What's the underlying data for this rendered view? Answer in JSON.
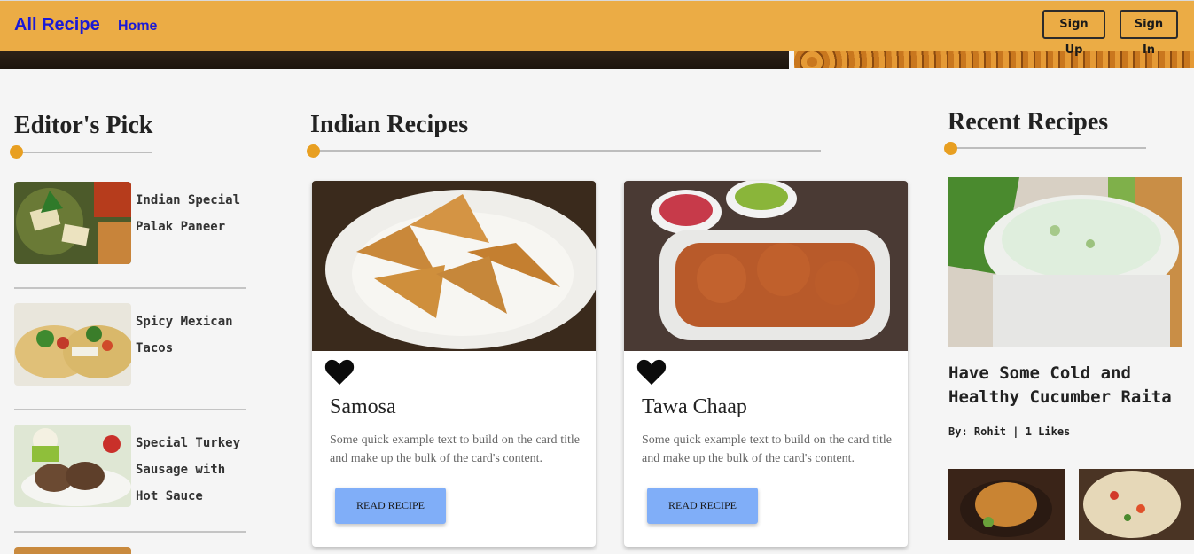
{
  "navbar": {
    "brand": "All Recipe",
    "home": "Home",
    "signup": "Sign Up",
    "signin": "Sign In"
  },
  "editors_pick": {
    "title": "Editor's Pick",
    "items": [
      {
        "title": "Indian Special Palak Paneer"
      },
      {
        "title": "Spicy Mexican Tacos"
      },
      {
        "title": "Special Turkey Sausage with Hot Sauce"
      }
    ]
  },
  "indian": {
    "title": "Indian Recipes",
    "cards": [
      {
        "title": "Samosa",
        "text": "Some quick example text to build on the card title and make up the bulk of the card's content.",
        "button": "Read Recipe"
      },
      {
        "title": "Tawa Chaap",
        "text": "Some quick example text to build on the card title and make up the bulk of the card's content.",
        "button": "Read Recipe"
      }
    ]
  },
  "recent": {
    "title": "Recent Recipes",
    "featured_title": "Have Some Cold and Healthy Cucumber Raita",
    "meta": "By: Rohit | 1 Likes"
  },
  "colors": {
    "navbar": "#ebac45",
    "brand": "#1a1ad6",
    "accent_dot": "#e89f21",
    "button": "#80aef8"
  },
  "icons": [
    "heart-icon"
  ]
}
